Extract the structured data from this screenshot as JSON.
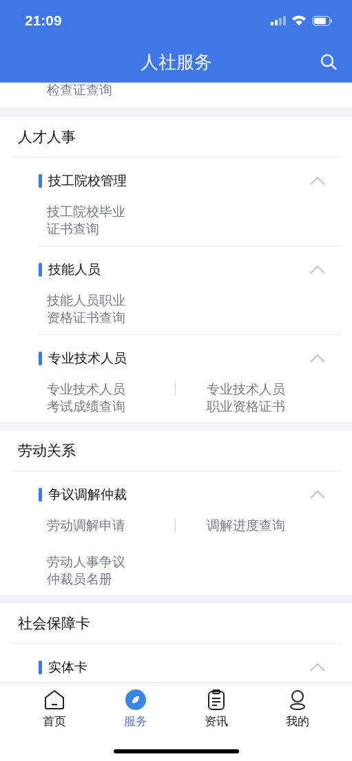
{
  "status_bar": {
    "time": "21:09"
  },
  "header": {
    "title": "人社服务"
  },
  "top_partial_item": "检查证查询",
  "sections": [
    {
      "title": "人才人事",
      "groups": [
        {
          "title": "技工院校管理",
          "expanded": true,
          "items": [
            "技工院校毕业证书查询"
          ]
        },
        {
          "title": "技能人员",
          "expanded": true,
          "items": [
            "技能人员职业资格证书查询"
          ]
        },
        {
          "title": "专业技术人员",
          "expanded": true,
          "items": [
            "专业技术人员考试成绩查询",
            "专业技术人员职业资格证书"
          ]
        }
      ]
    },
    {
      "title": "劳动关系",
      "groups": [
        {
          "title": "争议调解仲裁",
          "expanded": true,
          "items": [
            "劳动调解申请",
            "调解进度查询",
            "劳动人事争议仲裁员名册"
          ]
        }
      ]
    },
    {
      "title": "社会保障卡",
      "groups": [
        {
          "title": "实体卡",
          "expanded": true
        }
      ]
    }
  ],
  "tabs": [
    {
      "kind": "home",
      "label": "首页",
      "selected": false
    },
    {
      "kind": "service",
      "label": "服务",
      "selected": true
    },
    {
      "kind": "news",
      "label": "资讯",
      "selected": false
    },
    {
      "kind": "profile",
      "label": "我的",
      "selected": false
    }
  ]
}
